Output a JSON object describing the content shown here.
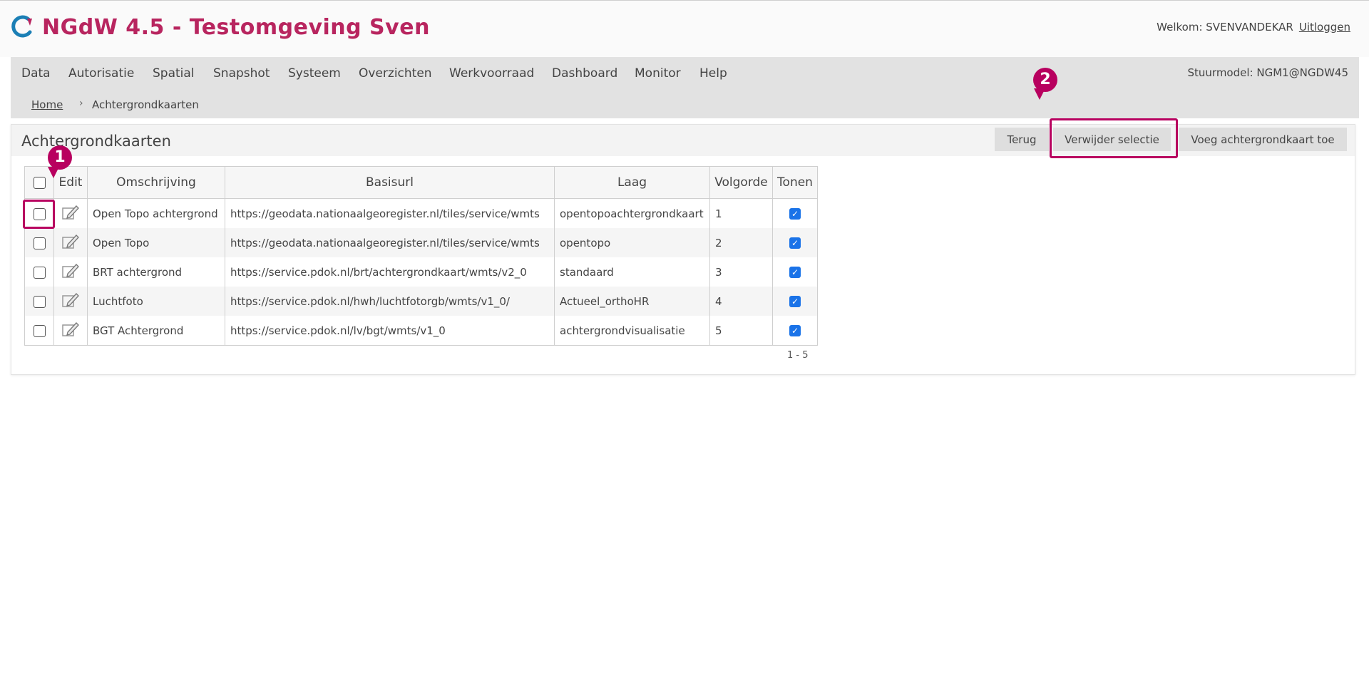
{
  "header": {
    "app_title": "NGdW 4.5 - Testomgeving Sven",
    "welcome_label": "Welkom: SVENVANDEKAR",
    "logout_label": "Uitloggen",
    "brand_color": "#b8255f",
    "logo_icon": "ngdw-logo-icon"
  },
  "nav": {
    "items": [
      "Data",
      "Autorisatie",
      "Spatial",
      "Snapshot",
      "Systeem",
      "Overzichten",
      "Werkvoorraad",
      "Dashboard",
      "Monitor",
      "Help"
    ],
    "stuurmodel": "Stuurmodel: NGM1@NGDW45"
  },
  "breadcrumb": {
    "home": "Home",
    "separator": "›",
    "current": "Achtergrondkaarten"
  },
  "panel": {
    "title": "Achtergrondkaarten",
    "buttons": {
      "back": "Terug",
      "delete_selection": "Verwijder selectie",
      "add": "Voeg achtergrondkaart toe"
    }
  },
  "table": {
    "columns": [
      "Edit",
      "Omschrijving",
      "Basisurl",
      "Laag",
      "Volgorde",
      "Tonen"
    ],
    "rows": [
      {
        "omschrijving": "Open Topo achtergrond",
        "basisurl": "https://geodata.nationaalgeoregister.nl/tiles/service/wmts",
        "laag": "opentopoachtergrondkaart",
        "volgorde": "1",
        "tonen": true,
        "selected": false
      },
      {
        "omschrijving": "Open Topo",
        "basisurl": "https://geodata.nationaalgeoregister.nl/tiles/service/wmts",
        "laag": "opentopo",
        "volgorde": "2",
        "tonen": true,
        "selected": false
      },
      {
        "omschrijving": "BRT achtergrond",
        "basisurl": "https://service.pdok.nl/brt/achtergrondkaart/wmts/v2_0",
        "laag": "standaard",
        "volgorde": "3",
        "tonen": true,
        "selected": false
      },
      {
        "omschrijving": "Luchtfoto",
        "basisurl": "https://service.pdok.nl/hwh/luchtfotorgb/wmts/v1_0/",
        "laag": "Actueel_orthoHR",
        "volgorde": "4",
        "tonen": true,
        "selected": false
      },
      {
        "omschrijving": "BGT Achtergrond",
        "basisurl": "https://service.pdok.nl/lv/bgt/wmts/v1_0",
        "laag": "achtergrondvisualisatie",
        "volgorde": "5",
        "tonen": true,
        "selected": false
      }
    ],
    "paging": "1 - 5"
  },
  "annotations": {
    "marker_1": "1",
    "marker_2": "2",
    "color": "#b8005f"
  }
}
